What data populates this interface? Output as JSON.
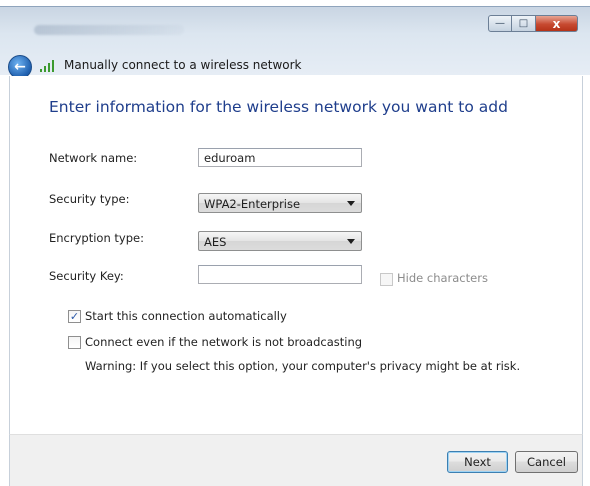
{
  "window": {
    "controls": {
      "minimize": "—",
      "maximize": "□",
      "close": "x"
    }
  },
  "header": {
    "back_icon": "back-arrow-icon",
    "signal_icon": "wireless-signal-icon",
    "title": "Manually connect to a wireless network"
  },
  "main": {
    "heading": "Enter information for the wireless network you want to add",
    "network_name": {
      "label": "Network name:",
      "value": "eduroam"
    },
    "security_type": {
      "label": "Security type:",
      "value": "WPA2-Enterprise"
    },
    "encryption_type": {
      "label": "Encryption type:",
      "value": "AES"
    },
    "security_key": {
      "label": "Security Key:",
      "value": "",
      "hide_characters_label": "Hide characters",
      "hide_characters_checked": false
    },
    "start_auto": {
      "label": "Start this connection automatically",
      "checked": true
    },
    "connect_even": {
      "label": "Connect even if the network is not broadcasting",
      "checked": false
    },
    "warning": "Warning: If you select this option, your computer's privacy might be at risk."
  },
  "footer": {
    "next_label": "Next",
    "cancel_label": "Cancel"
  },
  "colors": {
    "heading": "#1f3e8c",
    "close_button": "#c74a31",
    "accent": "#3c7fb1"
  }
}
